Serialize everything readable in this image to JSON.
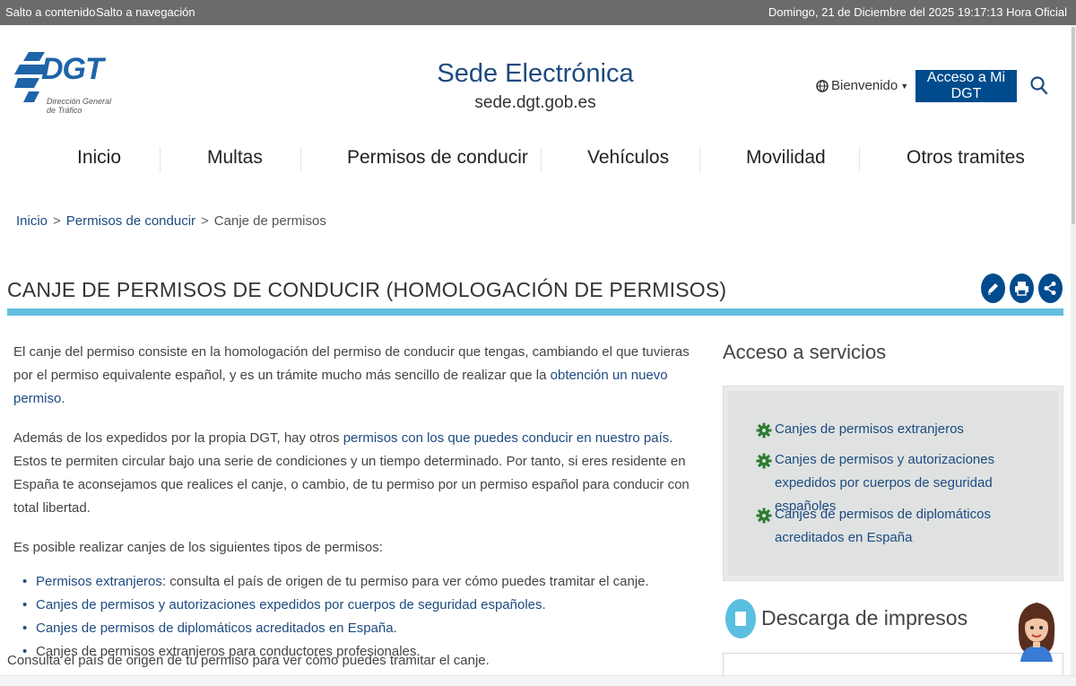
{
  "topbar": {
    "skip_content": "Salto a contenido",
    "skip_nav": "Salto a navegación",
    "datetime": "Domingo, 21 de Diciembre del 2025 19:17:13 Hora Oficial"
  },
  "header": {
    "logo_text": "DGT",
    "logo_subtitle": "Dirección General de Tráfico",
    "site_title": "Sede Electrónica",
    "site_url": "sede.dgt.gob.es",
    "welcome_label": "Bienvenido",
    "access_button": "Acceso a Mi DGT",
    "search_icon": "search-icon"
  },
  "nav": {
    "items": [
      {
        "label": "Inicio"
      },
      {
        "label": "Multas"
      },
      {
        "label": "Permisos de conducir"
      },
      {
        "label": "Vehículos"
      },
      {
        "label": "Movilidad"
      },
      {
        "label": "Otros tramites"
      }
    ]
  },
  "breadcrumb": {
    "items": [
      "Inicio",
      "Permisos de conducir",
      "Canje de permisos"
    ],
    "separator": ">"
  },
  "page": {
    "title": "CANJE DE PERMISOS DE CONDUCIR (HOMOLOGACIÓN DE PERMISOS)",
    "actions": [
      "edit-icon",
      "print-icon",
      "share-icon"
    ],
    "accent_color": "#62bfde",
    "brand_color": "#004b8d"
  },
  "content": {
    "p1_text": "El canje del permiso consiste en la homologación del permiso de conducir que tengas, cambiando el que tuvieras por el permiso equivalente español, y es un trámite mucho más sencillo de realizar que la ",
    "p1_link": "obtención un nuevo permiso",
    "p1_end": ".",
    "p2_text": "Además de los expedidos por la propia DGT, hay otros ",
    "p2_link": "permisos con los que puedes conducir en nuestro país",
    "p2_end": ". Estos te permiten circular bajo una serie de condiciones y un tiempo determinado. Por tanto, si eres residente en España te aconsejamos que realices el canje, o cambio, de tu permiso por un permiso español para conducir con total libertad.",
    "p3_text": "Es posible realizar canjes de los siguientes tipos de permisos:",
    "bullet1_link": "Permisos extranjeros",
    "bullet1_text": ": consulta el país de origen de tu permiso para ver cómo puedes tramitar el canje.",
    "bullet2_link": "Canjes de permisos y autorizaciones expedidos por cuerpos de seguridad españoles",
    "bullet2_end": ".",
    "bullet3_link": "Canjes de permisos de diplomáticos acreditados en España",
    "bullet3_end": ".",
    "bullet4_text": "Canjes de permisos extranjeros para conductores profesionales.",
    "closing": "Consulta el país de origen de tu permiso para ver cómo puedes tramitar el canje."
  },
  "sidebar": {
    "services_heading": "Acceso a servicios",
    "services": [
      {
        "label": "Canjes de permisos extranjeros",
        "icon": "gear-icon"
      },
      {
        "label": "Canjes de permisos y autorizaciones expedidos por cuerpos de seguridad españoles",
        "icon": "gear-icon"
      },
      {
        "label": "Canjes de permisos de diplomáticos acreditados en España",
        "icon": "gear-icon"
      }
    ],
    "icon_color": "#2e7d32",
    "downloads_heading": "Descarga de impresos",
    "downloads_icon": "document-icon"
  },
  "chat": {
    "icon": "assistant-avatar-icon"
  }
}
